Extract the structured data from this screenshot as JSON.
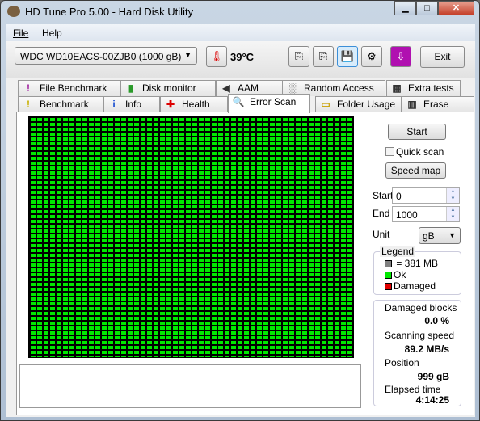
{
  "window": {
    "title": "HD Tune Pro 5.00 - Hard Disk Utility",
    "minimize": "▁",
    "maximize": "□",
    "close": "✕"
  },
  "menu": {
    "file": "File",
    "help": "Help"
  },
  "toolbar": {
    "drive": "WDC WD10EACS-00ZJB0 (1000 gB)",
    "temperature": "39°C",
    "exit": "Exit"
  },
  "tabs_top": [
    {
      "label": "File Benchmark",
      "icon": "file-benchmark-icon"
    },
    {
      "label": "Disk monitor",
      "icon": "disk-monitor-icon"
    },
    {
      "label": "AAM",
      "icon": "speaker-icon"
    },
    {
      "label": "Random Access",
      "icon": "random-access-icon"
    },
    {
      "label": "Extra tests",
      "icon": "extra-tests-icon"
    }
  ],
  "tabs_bottom": [
    {
      "label": "Benchmark",
      "icon": "exclamation-icon"
    },
    {
      "label": "Info",
      "icon": "info-icon"
    },
    {
      "label": "Health",
      "icon": "health-cross-icon"
    },
    {
      "label": "Error Scan",
      "icon": "magnifier-icon",
      "active": true
    },
    {
      "label": "Folder Usage",
      "icon": "folder-icon"
    },
    {
      "label": "Erase",
      "icon": "trash-icon"
    }
  ],
  "scan": {
    "start_button": "Start",
    "quick_scan": "Quick scan",
    "quick_scan_checked": false,
    "speed_map": "Speed map",
    "start_label": "Start",
    "start_value": "0",
    "end_label": "End",
    "end_value": "1000",
    "unit_label": "Unit",
    "unit_value": "gB",
    "block_status": "all ok"
  },
  "legend": {
    "title": "Legend",
    "block": "= 381 MB",
    "ok": "Ok",
    "damaged": "Damaged",
    "colors": {
      "block": "#808080",
      "ok": "#00e800",
      "damaged": "#e00000"
    }
  },
  "stats": {
    "damaged_label": "Damaged blocks",
    "damaged_value": "0.0 %",
    "speed_label": "Scanning speed",
    "speed_value": "89.2 MB/s",
    "position_label": "Position",
    "position_value": "999 gB",
    "elapsed_label": "Elapsed time",
    "elapsed_value": "4:14:25"
  }
}
